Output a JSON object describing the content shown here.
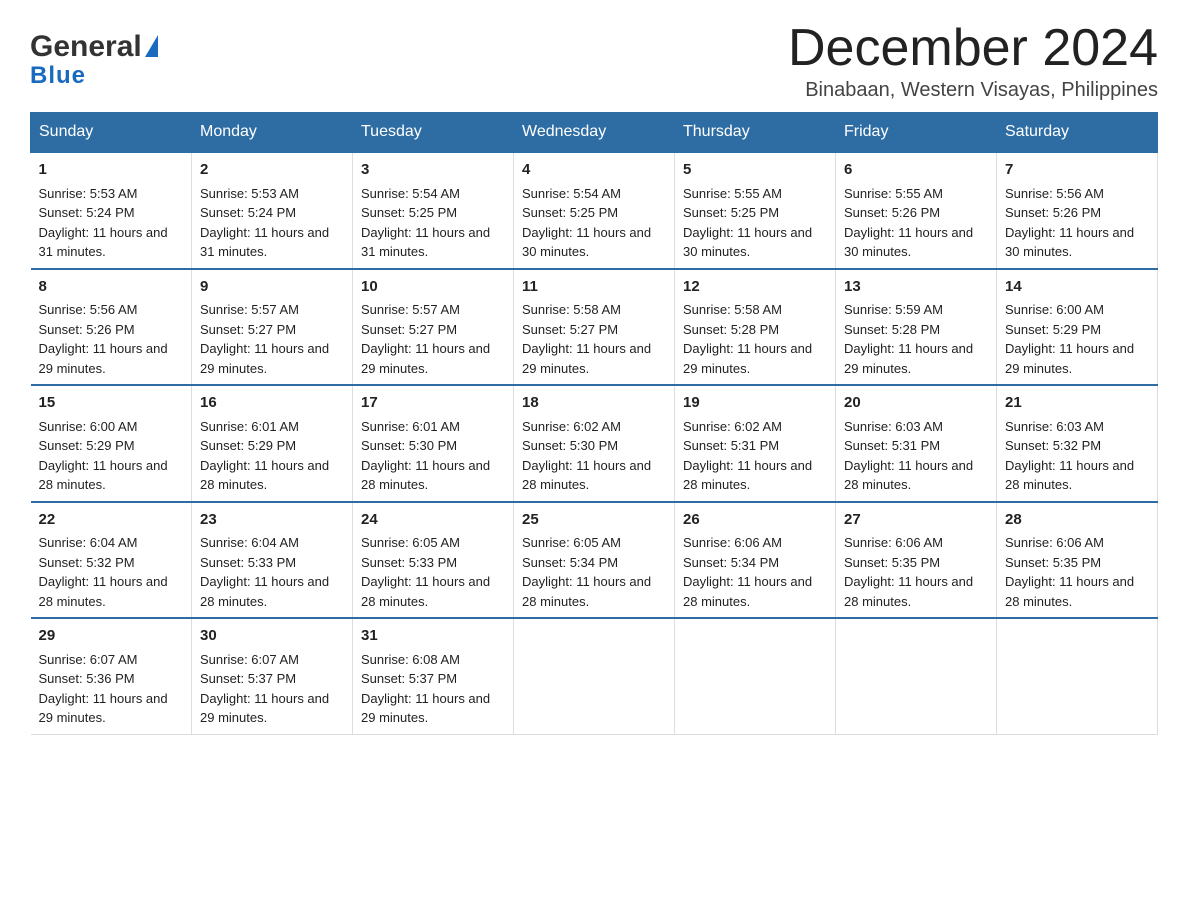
{
  "logo": {
    "general": "General",
    "blue": "Blue"
  },
  "title": "December 2024",
  "location": "Binabaan, Western Visayas, Philippines",
  "days_of_week": [
    "Sunday",
    "Monday",
    "Tuesday",
    "Wednesday",
    "Thursday",
    "Friday",
    "Saturday"
  ],
  "weeks": [
    [
      {
        "day": "1",
        "sunrise": "5:53 AM",
        "sunset": "5:24 PM",
        "daylight": "11 hours and 31 minutes."
      },
      {
        "day": "2",
        "sunrise": "5:53 AM",
        "sunset": "5:24 PM",
        "daylight": "11 hours and 31 minutes."
      },
      {
        "day": "3",
        "sunrise": "5:54 AM",
        "sunset": "5:25 PM",
        "daylight": "11 hours and 31 minutes."
      },
      {
        "day": "4",
        "sunrise": "5:54 AM",
        "sunset": "5:25 PM",
        "daylight": "11 hours and 30 minutes."
      },
      {
        "day": "5",
        "sunrise": "5:55 AM",
        "sunset": "5:25 PM",
        "daylight": "11 hours and 30 minutes."
      },
      {
        "day": "6",
        "sunrise": "5:55 AM",
        "sunset": "5:26 PM",
        "daylight": "11 hours and 30 minutes."
      },
      {
        "day": "7",
        "sunrise": "5:56 AM",
        "sunset": "5:26 PM",
        "daylight": "11 hours and 30 minutes."
      }
    ],
    [
      {
        "day": "8",
        "sunrise": "5:56 AM",
        "sunset": "5:26 PM",
        "daylight": "11 hours and 29 minutes."
      },
      {
        "day": "9",
        "sunrise": "5:57 AM",
        "sunset": "5:27 PM",
        "daylight": "11 hours and 29 minutes."
      },
      {
        "day": "10",
        "sunrise": "5:57 AM",
        "sunset": "5:27 PM",
        "daylight": "11 hours and 29 minutes."
      },
      {
        "day": "11",
        "sunrise": "5:58 AM",
        "sunset": "5:27 PM",
        "daylight": "11 hours and 29 minutes."
      },
      {
        "day": "12",
        "sunrise": "5:58 AM",
        "sunset": "5:28 PM",
        "daylight": "11 hours and 29 minutes."
      },
      {
        "day": "13",
        "sunrise": "5:59 AM",
        "sunset": "5:28 PM",
        "daylight": "11 hours and 29 minutes."
      },
      {
        "day": "14",
        "sunrise": "6:00 AM",
        "sunset": "5:29 PM",
        "daylight": "11 hours and 29 minutes."
      }
    ],
    [
      {
        "day": "15",
        "sunrise": "6:00 AM",
        "sunset": "5:29 PM",
        "daylight": "11 hours and 28 minutes."
      },
      {
        "day": "16",
        "sunrise": "6:01 AM",
        "sunset": "5:29 PM",
        "daylight": "11 hours and 28 minutes."
      },
      {
        "day": "17",
        "sunrise": "6:01 AM",
        "sunset": "5:30 PM",
        "daylight": "11 hours and 28 minutes."
      },
      {
        "day": "18",
        "sunrise": "6:02 AM",
        "sunset": "5:30 PM",
        "daylight": "11 hours and 28 minutes."
      },
      {
        "day": "19",
        "sunrise": "6:02 AM",
        "sunset": "5:31 PM",
        "daylight": "11 hours and 28 minutes."
      },
      {
        "day": "20",
        "sunrise": "6:03 AM",
        "sunset": "5:31 PM",
        "daylight": "11 hours and 28 minutes."
      },
      {
        "day": "21",
        "sunrise": "6:03 AM",
        "sunset": "5:32 PM",
        "daylight": "11 hours and 28 minutes."
      }
    ],
    [
      {
        "day": "22",
        "sunrise": "6:04 AM",
        "sunset": "5:32 PM",
        "daylight": "11 hours and 28 minutes."
      },
      {
        "day": "23",
        "sunrise": "6:04 AM",
        "sunset": "5:33 PM",
        "daylight": "11 hours and 28 minutes."
      },
      {
        "day": "24",
        "sunrise": "6:05 AM",
        "sunset": "5:33 PM",
        "daylight": "11 hours and 28 minutes."
      },
      {
        "day": "25",
        "sunrise": "6:05 AM",
        "sunset": "5:34 PM",
        "daylight": "11 hours and 28 minutes."
      },
      {
        "day": "26",
        "sunrise": "6:06 AM",
        "sunset": "5:34 PM",
        "daylight": "11 hours and 28 minutes."
      },
      {
        "day": "27",
        "sunrise": "6:06 AM",
        "sunset": "5:35 PM",
        "daylight": "11 hours and 28 minutes."
      },
      {
        "day": "28",
        "sunrise": "6:06 AM",
        "sunset": "5:35 PM",
        "daylight": "11 hours and 28 minutes."
      }
    ],
    [
      {
        "day": "29",
        "sunrise": "6:07 AM",
        "sunset": "5:36 PM",
        "daylight": "11 hours and 29 minutes."
      },
      {
        "day": "30",
        "sunrise": "6:07 AM",
        "sunset": "5:37 PM",
        "daylight": "11 hours and 29 minutes."
      },
      {
        "day": "31",
        "sunrise": "6:08 AM",
        "sunset": "5:37 PM",
        "daylight": "11 hours and 29 minutes."
      },
      null,
      null,
      null,
      null
    ]
  ],
  "labels": {
    "sunrise": "Sunrise:",
    "sunset": "Sunset:",
    "daylight": "Daylight:"
  }
}
